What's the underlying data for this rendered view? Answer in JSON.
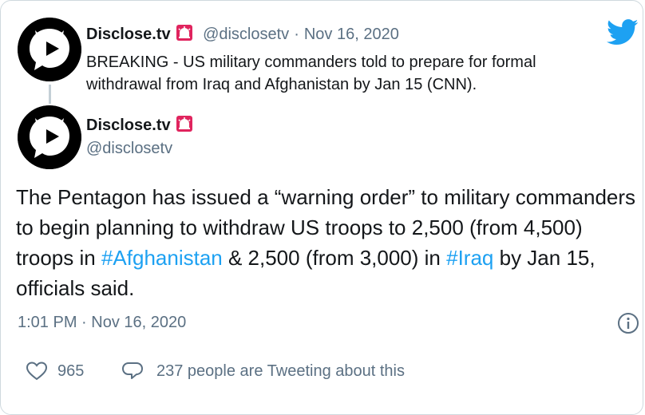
{
  "colors": {
    "twitter_blue": "#1da1f2",
    "muted": "#5b7083",
    "text": "#14171a",
    "alert_red": "#e0245e"
  },
  "parent_tweet": {
    "name": "Disclose.tv",
    "handle": "@disclosetv",
    "separator": "·",
    "date": "Nov 16, 2020",
    "text": "BREAKING - US military commanders told to prepare for formal withdrawal from Iraq and Afghanistan by Jan 15 (CNN)."
  },
  "main_tweet": {
    "name": "Disclose.tv",
    "handle": "@disclosetv",
    "body_1": "The Pentagon has issued a “warning order” to military commanders to begin planning to withdraw US troops to 2,500 (from 4,500) troops in ",
    "hashtag_1": "#Afghanistan",
    "body_2": " & 2,500 (from 3,000) in ",
    "hashtag_2": "#Iraq",
    "body_3": " by Jan 15, officials said.",
    "timestamp": "1:01 PM · Nov 16, 2020"
  },
  "actions": {
    "likes": "965",
    "tweeting": "237 people are Tweeting about this"
  },
  "icons": [
    "twitter-bird-icon",
    "disclose-logo-icon",
    "siren-icon",
    "info-icon",
    "heart-icon",
    "reply-bubble-icon"
  ]
}
